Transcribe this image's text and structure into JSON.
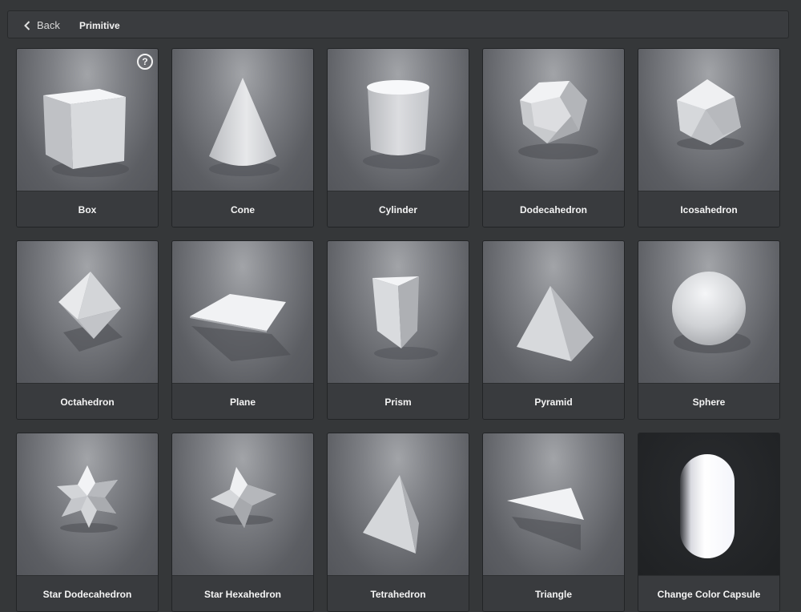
{
  "header": {
    "back_label": "Back",
    "title": "Primitive",
    "help_symbol": "?"
  },
  "items": [
    {
      "label": "Box",
      "icon": "box-icon"
    },
    {
      "label": "Cone",
      "icon": "cone-icon"
    },
    {
      "label": "Cylinder",
      "icon": "cylinder-icon"
    },
    {
      "label": "Dodecahedron",
      "icon": "dodecahedron-icon"
    },
    {
      "label": "Icosahedron",
      "icon": "icosahedron-icon"
    },
    {
      "label": "Octahedron",
      "icon": "octahedron-icon"
    },
    {
      "label": "Plane",
      "icon": "plane-icon"
    },
    {
      "label": "Prism",
      "icon": "prism-icon"
    },
    {
      "label": "Pyramid",
      "icon": "pyramid-icon"
    },
    {
      "label": "Sphere",
      "icon": "sphere-icon"
    },
    {
      "label": "Star Dodecahedron",
      "icon": "star-dodecahedron-icon"
    },
    {
      "label": "Star Hexahedron",
      "icon": "star-hexahedron-icon"
    },
    {
      "label": "Tetrahedron",
      "icon": "tetrahedron-icon"
    },
    {
      "label": "Triangle",
      "icon": "triangle-icon"
    },
    {
      "label": "Change Color Capsule",
      "icon": "capsule-icon"
    }
  ]
}
